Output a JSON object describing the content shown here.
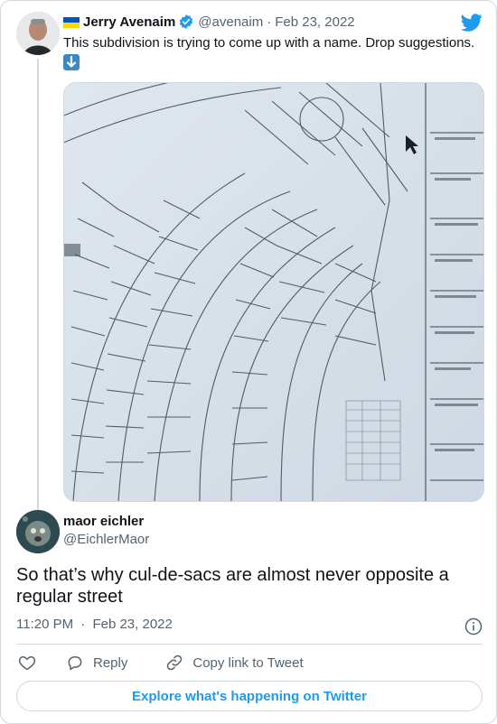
{
  "tweet": {
    "author_name": "Jerry Avenaim",
    "author_handle": "@avenaim",
    "separator": "·",
    "date": "Feb 23, 2022",
    "text": "This subdivision is trying to come up with a name. Drop suggestions.",
    "emoji": "down-arrow-emoji",
    "media_description_icon": "subdivision-plat-map-image"
  },
  "reply": {
    "author_name": "maor eichler",
    "author_handle": "@EichlerMaor",
    "text": "So that’s why cul-de-sacs are almost never opposite a regular street",
    "time": "11:20 PM",
    "separator": "·",
    "date": "Feb 23, 2022"
  },
  "actions": {
    "reply_label": "Reply",
    "copy_link_label": "Copy link to Tweet"
  },
  "explore": {
    "label": "Explore what's happening on Twitter"
  },
  "colors": {
    "accent": "#1d9bf0",
    "text_primary": "#0f1419",
    "text_secondary": "#536471",
    "border": "#cfd9de",
    "emoji_blue": "#3b88c3"
  }
}
